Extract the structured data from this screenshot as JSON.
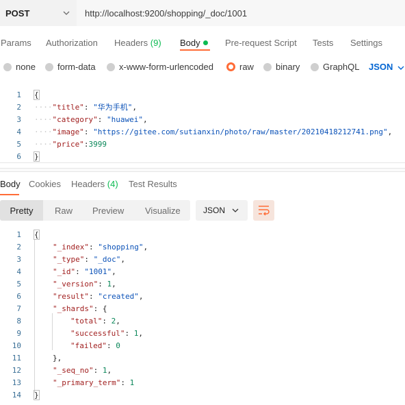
{
  "request": {
    "method": "POST",
    "url": "http://localhost:9200/shopping/_doc/1001"
  },
  "request_tabs": [
    {
      "label": "Params"
    },
    {
      "label": "Authorization"
    },
    {
      "label": "Headers",
      "count": "(9)"
    },
    {
      "label": "Body"
    },
    {
      "label": "Pre-request Script"
    },
    {
      "label": "Tests"
    },
    {
      "label": "Settings"
    }
  ],
  "body_options": {
    "none": "none",
    "form_data": "form-data",
    "urlencoded": "x-www-form-urlencoded",
    "raw": "raw",
    "binary": "binary",
    "graphql": "GraphQL",
    "format": "JSON"
  },
  "request_body": {
    "line_numbers": [
      "1",
      "2",
      "3",
      "4",
      "5",
      "6"
    ],
    "open_brace": "{",
    "close_brace": "}",
    "fields": [
      {
        "key": "\"title\"",
        "sep": ": ",
        "value": "\"华为手机\"",
        "trail": ","
      },
      {
        "key": "\"category\"",
        "sep": ": ",
        "value": "\"huawei\"",
        "trail": ","
      },
      {
        "key": "\"image\"",
        "sep": ": ",
        "value": "\"https://gitee.com/sutianxin/photo/raw/master/20210418212741.png\"",
        "trail": ","
      },
      {
        "key": "\"price\"",
        "sep": ":",
        "value": "3999",
        "trail": ""
      }
    ]
  },
  "response_tabs": [
    {
      "label": "Body"
    },
    {
      "label": "Cookies"
    },
    {
      "label": "Headers",
      "count": "(4)"
    },
    {
      "label": "Test Results"
    }
  ],
  "view": {
    "pretty": "Pretty",
    "raw": "Raw",
    "preview": "Preview",
    "visualize": "Visualize",
    "format": "JSON"
  },
  "response_body": {
    "line_numbers": [
      "1",
      "2",
      "3",
      "4",
      "5",
      "6",
      "7",
      "8",
      "9",
      "10",
      "11",
      "12",
      "13",
      "14"
    ],
    "open_brace": "{",
    "close_brace": "}",
    "index_key": "\"_index\"",
    "index_val": "\"shopping\"",
    "type_key": "\"_type\"",
    "type_val": "\"_doc\"",
    "id_key": "\"_id\"",
    "id_val": "\"1001\"",
    "version_key": "\"_version\"",
    "version_val": "1",
    "result_key": "\"result\"",
    "result_val": "\"created\"",
    "shards_key": "\"_shards\"",
    "total_key": "\"total\"",
    "total_val": "2",
    "successful_key": "\"successful\"",
    "successful_val": "1",
    "failed_key": "\"failed\"",
    "failed_val": "0",
    "shards_close": "},",
    "seq_key": "\"_seq_no\"",
    "seq_val": "1",
    "term_key": "\"_primary_term\"",
    "term_val": "1"
  },
  "colors": {
    "accent": "#ff6c37",
    "green": "#0cbb52",
    "link_blue": "#0265d2"
  }
}
